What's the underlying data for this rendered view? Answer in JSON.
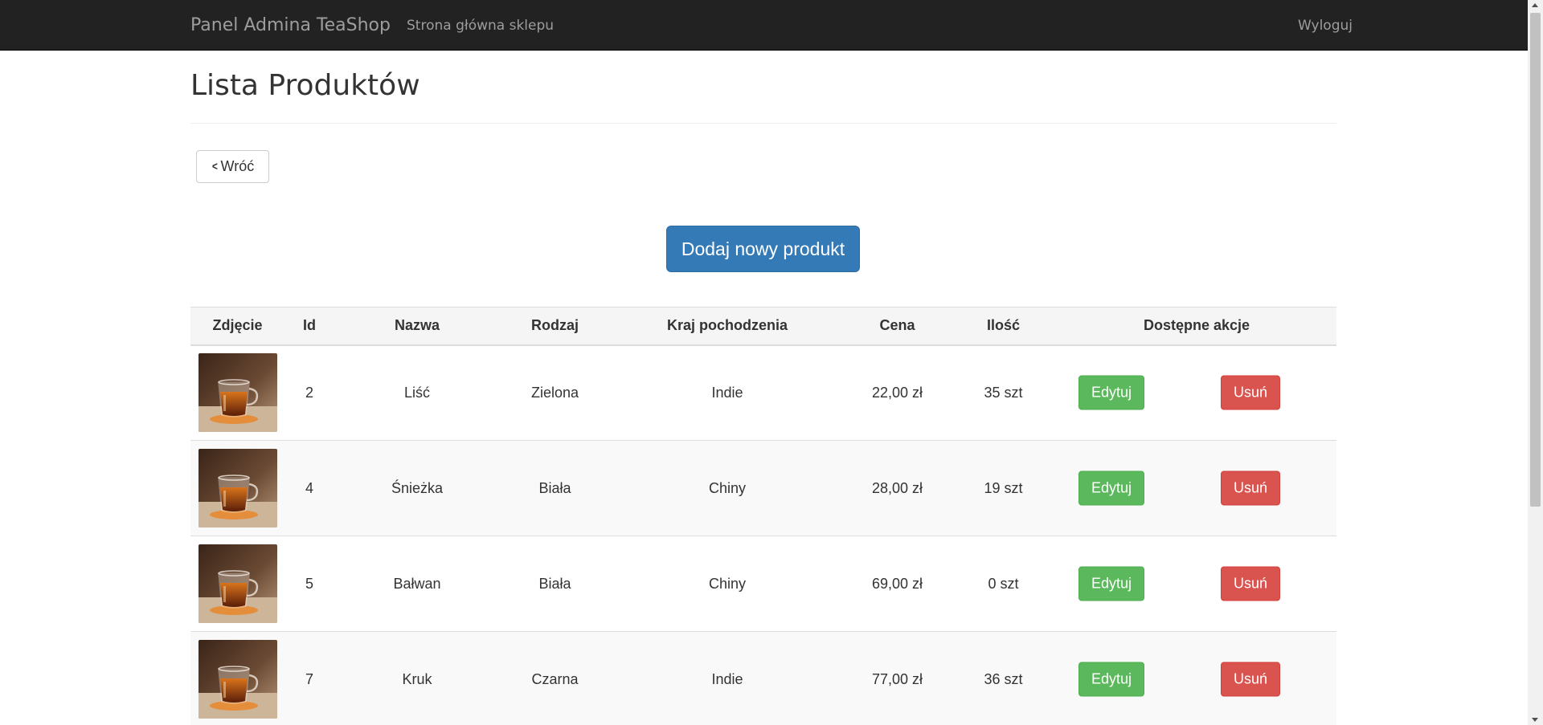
{
  "navbar": {
    "brand": "Panel Admina TeaShop",
    "home_link": "Strona główna sklepu",
    "logout": "Wyloguj",
    "background_color": "#222222"
  },
  "page": {
    "title": "Lista Produktów",
    "back_button": "Wróć",
    "back_icon": "chevron-left-icon",
    "add_button": "Dodaj nowy produkt"
  },
  "table": {
    "headers": {
      "photo": "Zdjęcie",
      "id": "Id",
      "name": "Nazwa",
      "type": "Rodzaj",
      "origin": "Kraj pochodzenia",
      "price": "Cena",
      "quantity": "Ilość",
      "actions": "Dostępne akcje"
    },
    "rows": [
      {
        "image": "tea-glass-photo",
        "id": "2",
        "name": "Liść",
        "type": "Zielona",
        "origin": "Indie",
        "price": "22,00 zł",
        "quantity": "35 szt",
        "edit": "Edytuj",
        "delete": "Usuń"
      },
      {
        "image": "tea-glass-photo",
        "id": "4",
        "name": "Śnieżka",
        "type": "Biała",
        "origin": "Chiny",
        "price": "28,00 zł",
        "quantity": "19 szt",
        "edit": "Edytuj",
        "delete": "Usuń"
      },
      {
        "image": "tea-glass-photo",
        "id": "5",
        "name": "Bałwan",
        "type": "Biała",
        "origin": "Chiny",
        "price": "69,00 zł",
        "quantity": "0 szt",
        "edit": "Edytuj",
        "delete": "Usuń"
      },
      {
        "image": "tea-glass-photo",
        "id": "7",
        "name": "Kruk",
        "type": "Czarna",
        "origin": "Indie",
        "price": "77,00 zł",
        "quantity": "36 szt",
        "edit": "Edytuj",
        "delete": "Usuń"
      }
    ]
  },
  "colors": {
    "primary": "#337ab7",
    "success": "#5cb85c",
    "danger": "#d9534f"
  }
}
